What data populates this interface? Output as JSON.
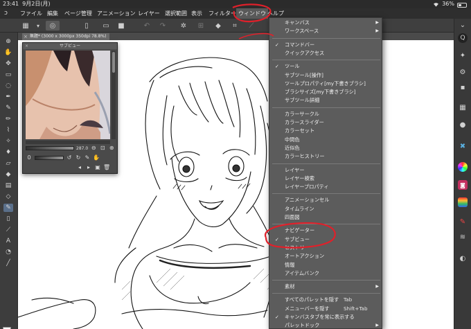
{
  "status_bar": {
    "time": "23:41",
    "date": "9月2日(月)",
    "battery": "36%",
    "battery_level": 0.36
  },
  "menu": {
    "items": [
      {
        "label": "ファイル"
      },
      {
        "label": "編集"
      },
      {
        "label": "ページ管理"
      },
      {
        "label": "アニメーション"
      },
      {
        "label": "レイヤー"
      },
      {
        "label": "選択範囲"
      },
      {
        "label": "表示"
      },
      {
        "label": "フィルター"
      },
      {
        "label": "ウィンドウ"
      },
      {
        "label": "ヘルプ"
      }
    ],
    "active_item": "ウィンドウ"
  },
  "document_tab": {
    "label": "無題* (3000 x 3000px 350dpi 78.8%)"
  },
  "subview": {
    "title": "サブビュー",
    "zoom_value": "287.0"
  },
  "window_menu": {
    "items": [
      {
        "label": "キャンバス",
        "submenu": true
      },
      {
        "label": "ワークスペース",
        "submenu": true
      },
      {
        "separator": true
      },
      {
        "label": "コマンドバー",
        "checked": true
      },
      {
        "label": "クイックアクセス"
      },
      {
        "separator": true
      },
      {
        "label": "ツール",
        "checked": true
      },
      {
        "label": "サブツール[操作]"
      },
      {
        "label": "ツールプロパティ[my下書きブラシ]"
      },
      {
        "label": "ブラシサイズ[my下書きブラシ]"
      },
      {
        "label": "サブツール詳細"
      },
      {
        "separator": true
      },
      {
        "label": "カラーサークル"
      },
      {
        "label": "カラースライダー"
      },
      {
        "label": "カラーセット"
      },
      {
        "label": "中間色"
      },
      {
        "label": "近似色"
      },
      {
        "label": "カラーヒストリー"
      },
      {
        "separator": true
      },
      {
        "label": "レイヤー"
      },
      {
        "label": "レイヤー検索"
      },
      {
        "label": "レイヤープロパティ"
      },
      {
        "separator": true
      },
      {
        "label": "アニメーションセル"
      },
      {
        "label": "タイムライン"
      },
      {
        "label": "四面図"
      },
      {
        "separator": true
      },
      {
        "label": "ナビゲーター"
      },
      {
        "label": "サブビュー",
        "checked": true
      },
      {
        "label": "ヒストリー"
      },
      {
        "label": "オートアクション"
      },
      {
        "label": "情報"
      },
      {
        "label": "アイテムバンク"
      },
      {
        "separator": true
      },
      {
        "label": "素材",
        "submenu": true
      },
      {
        "separator": true
      },
      {
        "label": "すべてのパレットを隠す",
        "shortcut": "Tab"
      },
      {
        "label": "メニューバーを隠す",
        "shortcut": "Shift+Tab"
      },
      {
        "label": "キャンバスタブを常に表示する",
        "checked": true
      },
      {
        "label": "パレットドック",
        "submenu": true
      }
    ]
  },
  "colors": {
    "menu_bg": "#5c5c5c",
    "annotation": "#e0202a",
    "canvas": "#ffffff"
  },
  "icons": {
    "toolbar": [
      "grid-icon",
      "app-logo-icon",
      "new-document-icon",
      "open-folder-icon",
      "save-icon",
      "undo-icon",
      "redo-icon",
      "snap-icon",
      "transform-icon",
      "fill-icon",
      "crop-icon",
      "ruler-icon"
    ],
    "right_strip": [
      "navigator-icon",
      "color-wheel-icon",
      "layers-icon"
    ]
  }
}
